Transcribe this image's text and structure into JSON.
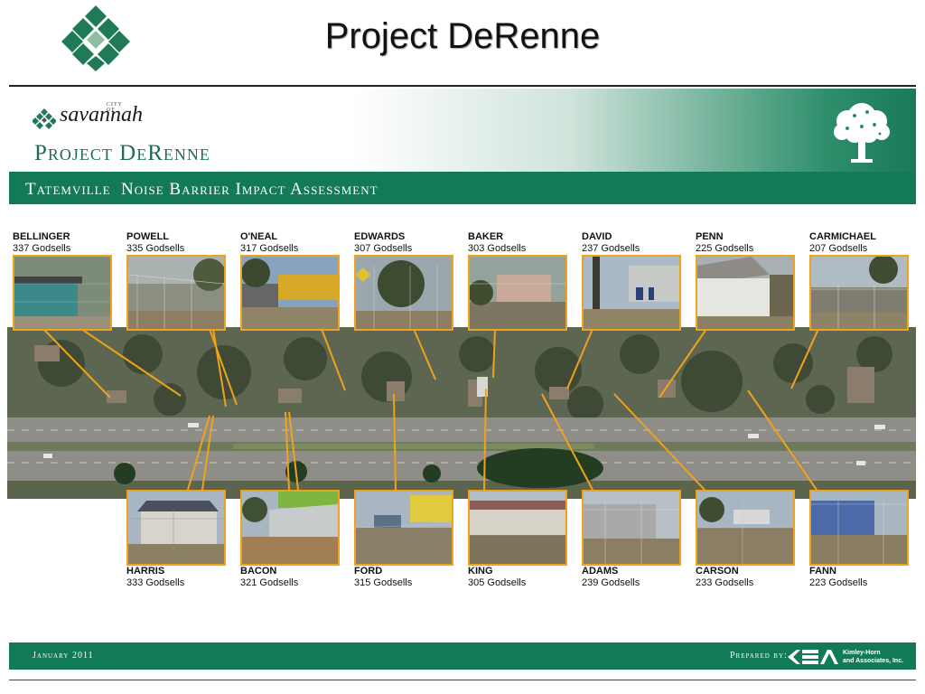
{
  "slide": {
    "title": "Project DeRenne"
  },
  "banner": {
    "brand_prefix": "CITY OF",
    "brand": "savannah",
    "project_name": "Project DeRenne",
    "subtitle": "Tatemville  Noise Barrier Impact Assessment"
  },
  "colors": {
    "brand_green": "#137a57",
    "photo_border": "#f0a21c",
    "leader_line": "#f0a21c"
  },
  "icons": {
    "logo": "diamond-logo-icon",
    "tree": "tree-icon",
    "savannah": "savannah-diamond-icon"
  },
  "top_row": [
    {
      "name": "BELLINGER",
      "address": "337 Godsells"
    },
    {
      "name": "POWELL",
      "address": "335 Godsells"
    },
    {
      "name": "O'NEAL",
      "address": "317 Godsells"
    },
    {
      "name": "EDWARDS",
      "address": "307 Godsells"
    },
    {
      "name": "BAKER",
      "address": "303 Godsells"
    },
    {
      "name": "DAVID",
      "address": "237 Godsells"
    },
    {
      "name": "PENN",
      "address": "225 Godsells"
    },
    {
      "name": "CARMICHAEL",
      "address": "207 Godsells"
    }
  ],
  "bottom_row": [
    {
      "name": "HARRIS",
      "address": "333 Godsells"
    },
    {
      "name": "BACON",
      "address": "321 Godsells"
    },
    {
      "name": "FORD",
      "address": "315 Godsells"
    },
    {
      "name": "KING",
      "address": "305 Godsells"
    },
    {
      "name": "ADAMS",
      "address": "239 Godsells"
    },
    {
      "name": "CARSON",
      "address": "233 Godsells"
    },
    {
      "name": "FANN",
      "address": "223 Godsells"
    }
  ],
  "footer": {
    "date": "January 2011",
    "prepared_by": "Prepared by:",
    "firm_line1": "Kimley-Horn",
    "firm_line2": "and Associates, Inc."
  }
}
